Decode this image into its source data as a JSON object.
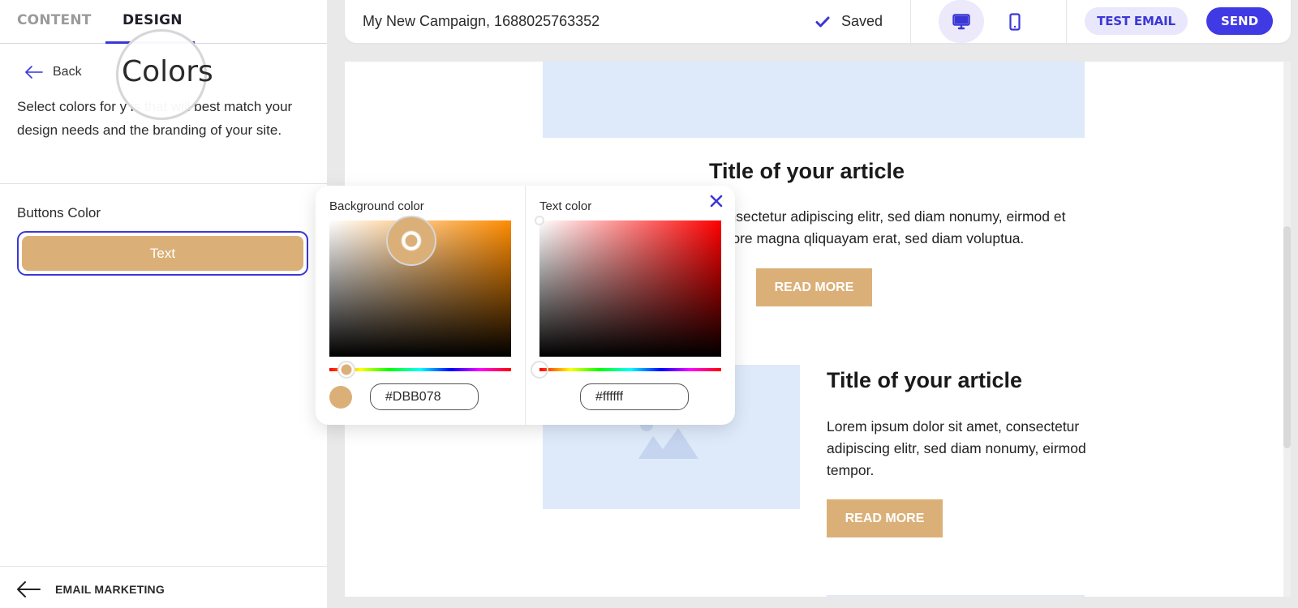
{
  "left_panel": {
    "tabs": [
      {
        "label": "CONTENT",
        "active": false
      },
      {
        "label": "DESIGN",
        "active": true
      }
    ],
    "back_label": "Back",
    "page_title": "Colors",
    "description": "Select colors for y        is that will best match your design needs and the branding of your site.",
    "buttons_color_label": "Buttons Color",
    "button_preview_text": "Text",
    "footer_link_label": "EMAIL MARKETING"
  },
  "header": {
    "campaign_name": "My New Campaign, 1688025763352",
    "status": "Saved",
    "device_options": [
      {
        "name": "desktop",
        "icon": "monitor-icon",
        "selected": true
      },
      {
        "name": "mobile",
        "icon": "smartphone-icon",
        "selected": false
      }
    ],
    "test_email_label": "TEST EMAIL",
    "send_label": "SEND"
  },
  "canvas": {
    "articles": [
      {
        "title": "Title of your article",
        "body_visible": "consectetur adipiscing elitr, sed diam nonumy, eirmod et dolore magna qliquayam erat, sed diam voluptua.",
        "button": "READ MORE"
      },
      {
        "title": "Title of your article",
        "body": "Lorem ipsum dolor sit amet, consectetur adipiscing elitr, sed diam nonumy, eirmod tempor.",
        "button": "READ MORE"
      }
    ]
  },
  "color_picker": {
    "background": {
      "label": "Background color",
      "hex": "#DBB078",
      "hue_base": "#ff8c00"
    },
    "text": {
      "label": "Text color",
      "hex": "#ffffff",
      "hue_base": "#ff0000"
    },
    "close_icon": "close-icon"
  },
  "colors": {
    "accent": "#3b37d6",
    "send_button": "#3f3ae3",
    "button_color": "#dbb078",
    "image_placeholder": "#deeafa"
  }
}
